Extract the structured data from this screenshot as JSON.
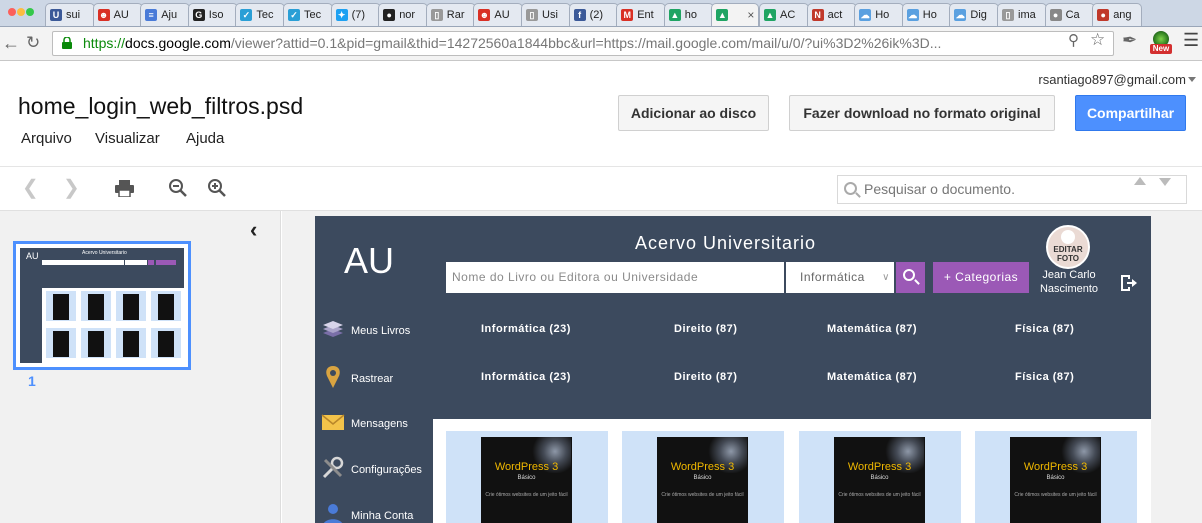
{
  "browser": {
    "tabs": [
      {
        "label": "sui",
        "icon": "shield-icon",
        "color": "#3b5998"
      },
      {
        "label": "AU",
        "icon": "devil-icon",
        "color": "#d93025"
      },
      {
        "label": "Aju",
        "icon": "docs-icon",
        "color": "#4a7bd8"
      },
      {
        "label": "Iso",
        "icon": "gitter-icon",
        "color": "#222222"
      },
      {
        "label": "Tec",
        "icon": "check-icon",
        "color": "#2a9fd6"
      },
      {
        "label": "Tec",
        "icon": "check-icon",
        "color": "#2a9fd6"
      },
      {
        "label": "(7)",
        "icon": "twitter-icon",
        "color": "#1da1f2"
      },
      {
        "label": "nor",
        "icon": "github-icon",
        "color": "#222222"
      },
      {
        "label": "Rar",
        "icon": "page-icon",
        "color": "#999999"
      },
      {
        "label": "AU",
        "icon": "devil-icon",
        "color": "#d93025"
      },
      {
        "label": "Usi",
        "icon": "page-icon",
        "color": "#999999"
      },
      {
        "label": "(2)",
        "icon": "facebook-icon",
        "color": "#3b5998"
      },
      {
        "label": "Ent",
        "icon": "gmail-icon",
        "color": "#d93025"
      },
      {
        "label": "ho",
        "icon": "drive-icon",
        "color": "#1fa463"
      },
      {
        "label": "",
        "icon": "drive-icon",
        "color": "#1fa463",
        "active": true
      },
      {
        "label": "AC",
        "icon": "drive-icon",
        "color": "#1fa463"
      },
      {
        "label": "act",
        "icon": "n-icon",
        "color": "#c0392b"
      },
      {
        "label": "Ho",
        "icon": "cloud-icon",
        "color": "#5aa0e0"
      },
      {
        "label": "Ho",
        "icon": "cloud-icon",
        "color": "#5aa0e0"
      },
      {
        "label": "Dig",
        "icon": "cloud-icon",
        "color": "#5aa0e0"
      },
      {
        "label": "ima",
        "icon": "page-icon",
        "color": "#999999"
      },
      {
        "label": "Ca",
        "icon": "circle-icon",
        "color": "#888888"
      },
      {
        "label": "ang",
        "icon": "cookie-icon",
        "color": "#c0392b"
      }
    ],
    "tab_close": "×",
    "url": {
      "scheme": "https://",
      "host": "docs.google.com",
      "rest": "/viewer?attid=0.1&pid=gmail&thid=14272560a1844bbc&url=https://mail.google.com/mail/u/0/?ui%3D2%26ik%3D..."
    },
    "ext_badge": "New"
  },
  "header": {
    "account": "rsantiago897@gmail.com",
    "title": "home_login_web_filtros.psd",
    "menu": [
      "Arquivo",
      "Visualizar",
      "Ajuda"
    ],
    "buttons": {
      "add_to_drive": "Adicionar ao disco",
      "download": "Fazer download no formato original",
      "share": "Compartilhar"
    }
  },
  "doc_toolbar": {
    "search_placeholder": "Pesquisar o documento."
  },
  "thumbnails": {
    "page_number": "1",
    "mini_title": "Acervo Universitario",
    "mini_logo": "AU"
  },
  "page_content": {
    "logo": "AU",
    "heading": "Acervo Universitario",
    "search_placeholder": "Nome do Livro ou Editora ou Universidade",
    "select_value": "Informática",
    "categories_button": "+ Categorias",
    "avatar_label": "EDITAR FOTO",
    "user_name": "Jean Carlo Nascimento",
    "side_menu": [
      "Meus Livros",
      "Rastrear",
      "Mensagens",
      "Configurações",
      "Minha Conta"
    ],
    "category_rows": [
      [
        "Informática (23)",
        "Direito (87)",
        "Matemática (87)",
        "Física (87)"
      ],
      [
        "Informática (23)",
        "Direito (87)",
        "Matemática (87)",
        "Física (87)"
      ]
    ],
    "books": [
      {
        "title": "WordPress 3",
        "subtitle": "Básico",
        "tagline": "Crie ótimos websites de um jeito fácil"
      },
      {
        "title": "WordPress 3",
        "subtitle": "Básico",
        "tagline": "Crie ótimos websites de um jeito fácil"
      },
      {
        "title": "WordPress 3",
        "subtitle": "Básico",
        "tagline": "Crie ótimos websites de um jeito fácil"
      },
      {
        "title": "WordPress 3",
        "subtitle": "Básico",
        "tagline": "Crie ótimos websites de um jeito fácil"
      }
    ]
  },
  "colors": {
    "accent_blue": "#4d90fe",
    "page_navy": "#3c4a5e",
    "purple": "#9b59b6",
    "book_bg": "#cfe2f8"
  }
}
